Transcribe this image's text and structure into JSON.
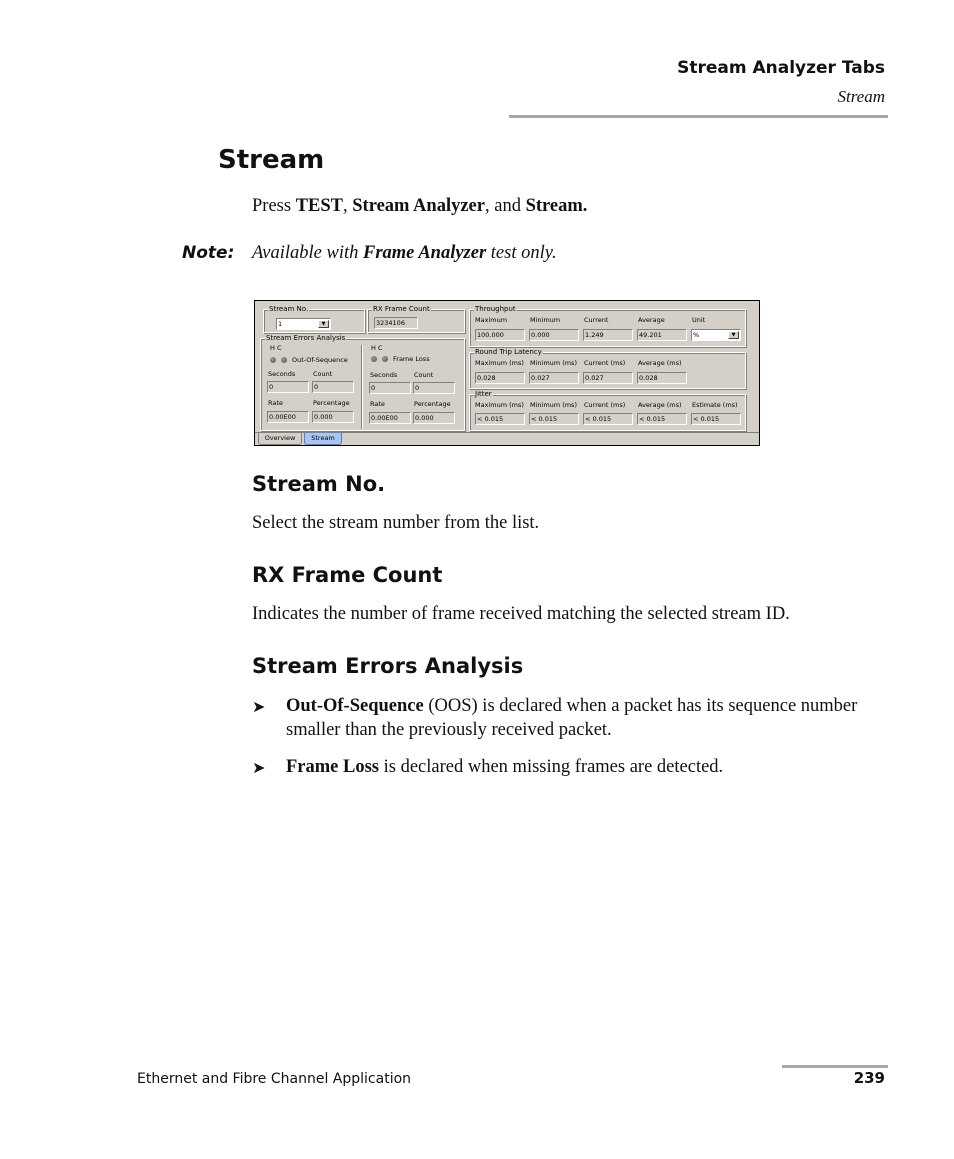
{
  "header": {
    "title": "Stream Analyzer Tabs",
    "subtitle": "Stream"
  },
  "page_title": "Stream",
  "instruction": {
    "prefix": "Press ",
    "b1": "TEST",
    "sep1": ", ",
    "b2": "Stream Analyzer",
    "sep2": ", and ",
    "b3": "Stream."
  },
  "note": {
    "label": "Note:",
    "prefix": "Available with ",
    "bold": "Frame Analyzer",
    "suffix": " test only."
  },
  "screenshot": {
    "stream_no": {
      "title": "Stream No.",
      "value": "1"
    },
    "rx_frame_count": {
      "title": "RX Frame Count",
      "value": "3234106"
    },
    "errors": {
      "title": "Stream Errors Analysis",
      "hc_label": "H  C",
      "oos": {
        "label": "Out-Of-Sequence",
        "seconds_label": "Seconds",
        "count_label": "Count",
        "seconds": "0",
        "count": "0",
        "rate_label": "Rate",
        "percentage_label": "Percentage",
        "rate": "0.00E00",
        "percentage": "0.000"
      },
      "frame_loss": {
        "label": "Frame Loss",
        "seconds_label": "Seconds",
        "count_label": "Count",
        "seconds": "0",
        "count": "0",
        "rate_label": "Rate",
        "percentage_label": "Percentage",
        "rate": "0.00E00",
        "percentage": "0.000"
      }
    },
    "throughput": {
      "title": "Throughput",
      "labels": [
        "Maximum",
        "Minimum",
        "Current",
        "Average",
        "Unit"
      ],
      "values": [
        "100.000",
        "0.000",
        "1.249",
        "49.201"
      ],
      "unit": "%"
    },
    "latency": {
      "title": "Round Trip Latency",
      "labels": [
        "Maximum (ms)",
        "Minimum (ms)",
        "Current (ms)",
        "Average (ms)"
      ],
      "values": [
        "0.028",
        "0.027",
        "0.027",
        "0.028"
      ]
    },
    "jitter": {
      "title": "Jitter",
      "labels": [
        "Maximum (ms)",
        "Minimum (ms)",
        "Current (ms)",
        "Average (ms)",
        "Estimate (ms)"
      ],
      "values": [
        "< 0.015",
        "< 0.015",
        "< 0.015",
        "< 0.015",
        "< 0.015"
      ]
    },
    "tabs": [
      {
        "label": "Overview",
        "active": false
      },
      {
        "label": "Stream",
        "active": true
      }
    ]
  },
  "sections": {
    "stream_no": {
      "title": "Stream No.",
      "body": "Select the stream number from the list."
    },
    "rx_frame_count": {
      "title": "RX Frame Count",
      "body": "Indicates the number of frame received matching the selected stream ID."
    },
    "errors": {
      "title": "Stream Errors Analysis",
      "bullets": [
        {
          "bold": "Out-Of-Sequence",
          "text": " (OOS) is declared when a packet has its sequence number smaller than the previously received packet."
        },
        {
          "bold": "Frame Loss",
          "text": " is declared when missing frames are detected."
        }
      ]
    }
  },
  "footer": {
    "left": "Ethernet and Fibre Channel Application",
    "page": "239"
  }
}
